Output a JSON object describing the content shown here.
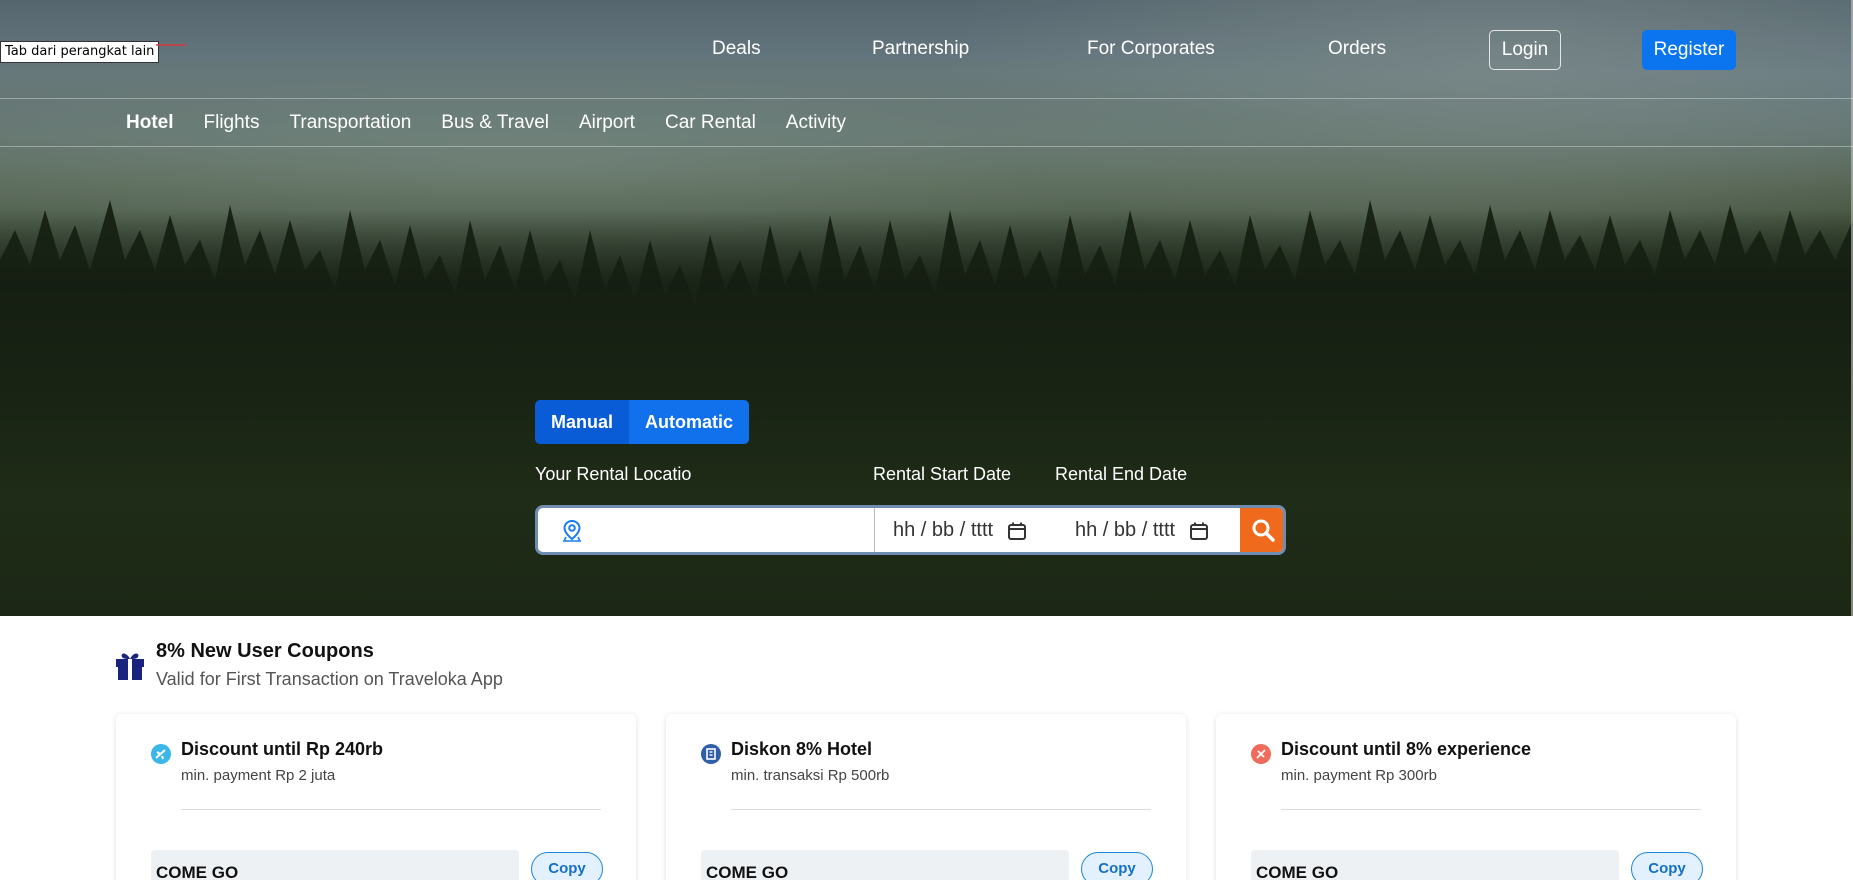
{
  "tab_notice": "Tab dari perangkat lain",
  "topnav": {
    "links": [
      "Deals",
      "Partnership",
      "For Corporates",
      "Orders"
    ],
    "login": "Login",
    "register": "Register"
  },
  "subnav": {
    "items": [
      "Hotel",
      "Flights",
      "Transportation",
      "Bus & Travel",
      "Airport",
      "Car Rental",
      "Activity"
    ],
    "active": "Hotel"
  },
  "search": {
    "modes": [
      "Manual",
      "Automatic"
    ],
    "location_label": "Your Rental Locatio",
    "start_label": "Rental Start Date",
    "end_label": "Rental End Date",
    "location_value": "",
    "start_placeholder": "hh / bb / tttt",
    "end_placeholder": "hh / bb / tttt"
  },
  "coupons": {
    "title": "8% New User Coupons",
    "subtitle": "Valid for First Transaction on Traveloka App",
    "cards": [
      {
        "title": "Discount until Rp 240rb",
        "min": "min. payment Rp 2 juta",
        "code": "COME GO",
        "copy": "Copy",
        "icon": "plane-icon",
        "color": "#3ab7e8"
      },
      {
        "title": "Diskon 8% Hotel",
        "min": "min. transaksi Rp 500rb",
        "code": "COME GO",
        "copy": "Copy",
        "icon": "building-icon",
        "color": "#2f5fa8"
      },
      {
        "title": "Discount until 8% experience",
        "min": "min. payment Rp 300rb",
        "code": "COME GO",
        "copy": "Copy",
        "icon": "ticket-icon",
        "color": "#ef6b5b"
      }
    ]
  },
  "colors": {
    "brand_blue": "#0b75f0",
    "search_orange": "#f06a1d"
  }
}
